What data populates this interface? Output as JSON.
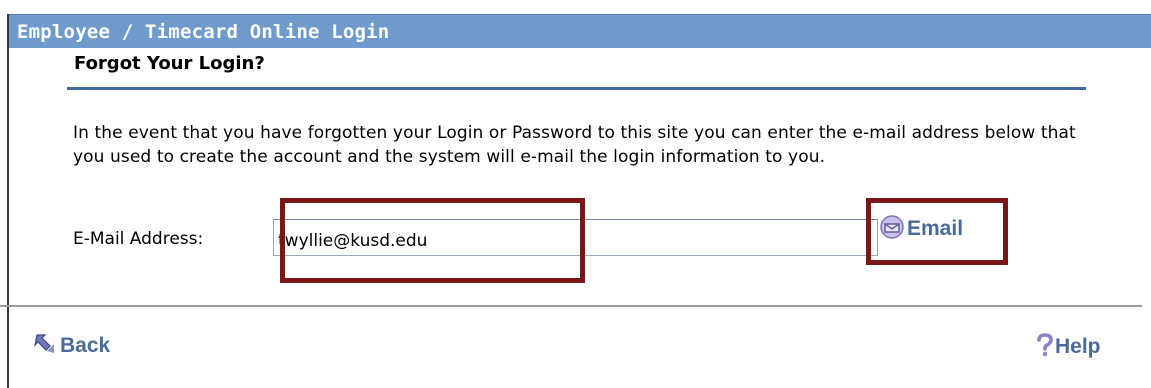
{
  "window": {
    "title": "Employee / Timecard Online Login"
  },
  "form": {
    "heading": "Forgot Your Login?",
    "description": "In the event that you have forgotten your Login or Password to this site you can enter the e-mail address below that you used to create the account and the system will e-mail the login information to you.",
    "email_label": "E-Mail Address:",
    "email_value": "twyllie@kusd.edu",
    "email_button_label": "Email",
    "email_button_icon": "envelope-icon"
  },
  "footer": {
    "back_label": "Back",
    "back_icon": "back-arrow-icon",
    "help_label": "Help",
    "help_icon": "question-mark-icon"
  },
  "colors": {
    "title_bar": "#6e9bcb",
    "rule": "#3f6e9e",
    "highlight": "#7a1818",
    "link": "#4a6a9a"
  }
}
